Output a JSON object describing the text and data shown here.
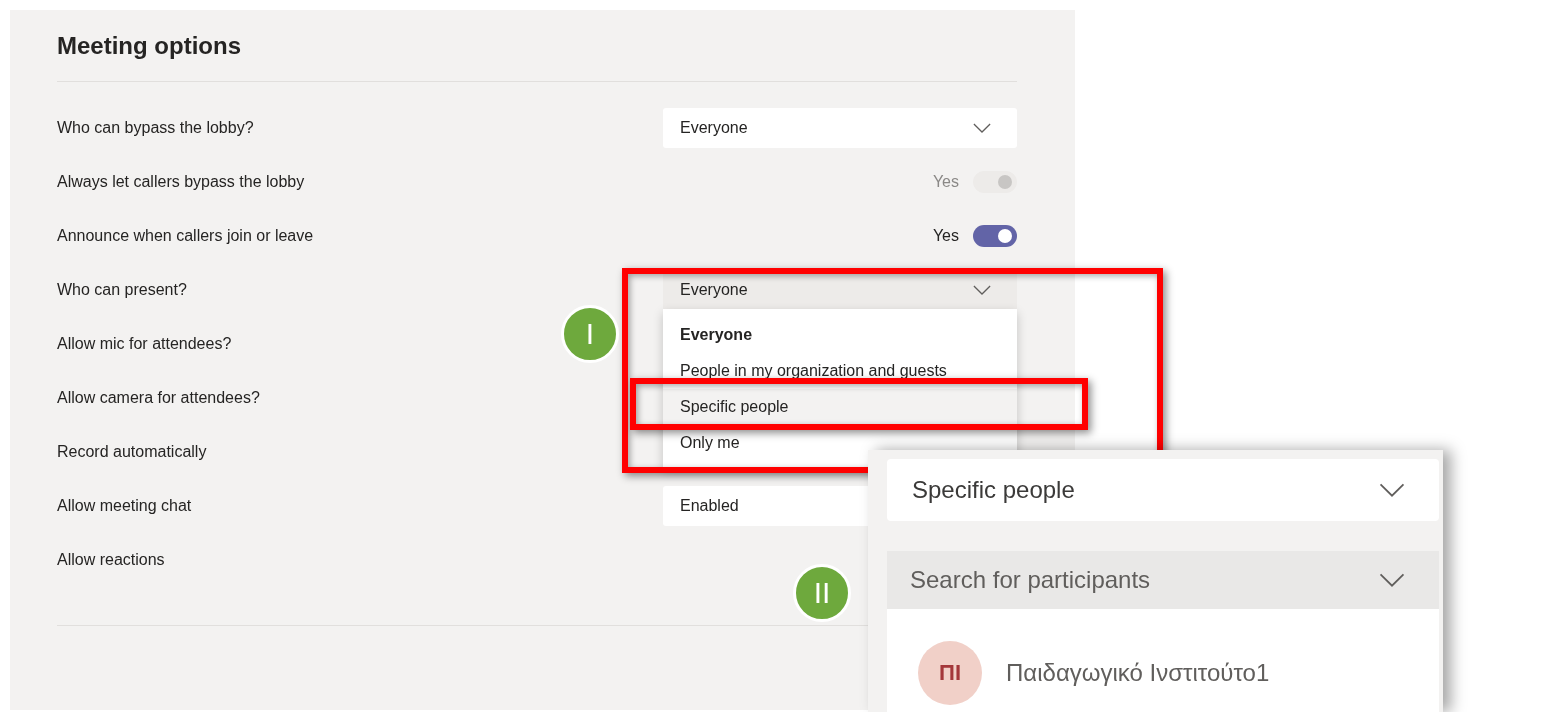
{
  "title": "Meeting options",
  "settings": [
    {
      "label": "Who can bypass the lobby?",
      "kind": "dropdown",
      "value": "Everyone",
      "open": false
    },
    {
      "label": "Always let callers bypass the lobby",
      "kind": "toggle",
      "value": "Yes",
      "on": true,
      "disabled": true
    },
    {
      "label": "Announce when callers join or leave",
      "kind": "toggle",
      "value": "Yes",
      "on": true,
      "disabled": false
    },
    {
      "label": "Who can present?",
      "kind": "dropdown",
      "value": "Everyone",
      "open": true,
      "options": [
        {
          "label": "Everyone",
          "selected": true,
          "highlighted": false
        },
        {
          "label": "People in my organization and guests",
          "selected": false,
          "highlighted": false
        },
        {
          "label": "Specific people",
          "selected": false,
          "highlighted": true
        },
        {
          "label": "Only me",
          "selected": false,
          "highlighted": false
        }
      ]
    },
    {
      "label": "Allow mic for attendees?",
      "kind": "label"
    },
    {
      "label": "Allow camera for attendees?",
      "kind": "label"
    },
    {
      "label": "Record automatically",
      "kind": "label"
    },
    {
      "label": "Allow meeting chat",
      "kind": "dropdown",
      "value": "Enabled",
      "open": false
    },
    {
      "label": "Allow reactions",
      "kind": "label"
    }
  ],
  "markers": [
    {
      "label": "I"
    },
    {
      "label": "II"
    }
  ],
  "inset": {
    "dropdown_value": "Specific people",
    "search_placeholder": "Search for participants",
    "participants": [
      {
        "initials": "ΠΙ",
        "name": "Παιδαγωγικό Ινστιτούτο1"
      }
    ]
  }
}
